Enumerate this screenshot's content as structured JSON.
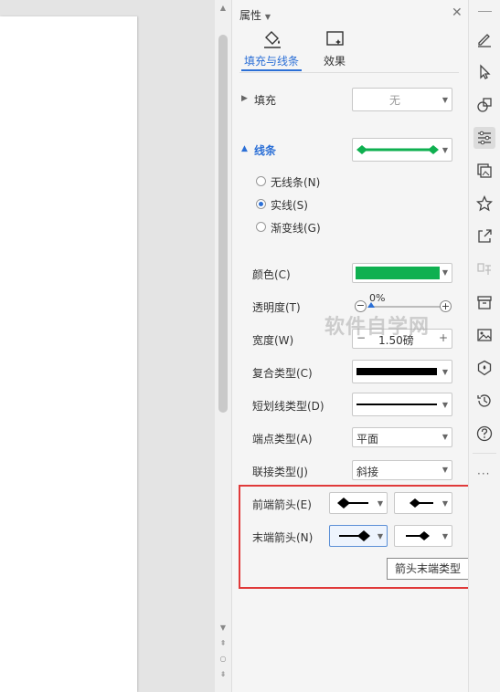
{
  "panel": {
    "title": "属性",
    "tabs": [
      {
        "label": "填充与线条",
        "icon": "fill-bucket-icon",
        "active": true
      },
      {
        "label": "效果",
        "icon": "effects-icon",
        "active": false
      }
    ],
    "fill": {
      "label": "填充",
      "value": "无"
    },
    "line": {
      "label": "线条",
      "options": [
        "无线条(N)",
        "实线(S)",
        "渐变线(G)"
      ],
      "selected": "实线(S)"
    },
    "color": {
      "label": "颜色(C)",
      "value": "#0fb050"
    },
    "transparency": {
      "label": "透明度(T)",
      "value": "0%"
    },
    "width": {
      "label": "宽度(W)",
      "value": "1.50磅"
    },
    "compound": {
      "label": "复合类型(C)"
    },
    "dash": {
      "label": "短划线类型(D)"
    },
    "cap": {
      "label": "端点类型(A)",
      "value": "平面"
    },
    "join": {
      "label": "联接类型(J)",
      "value": "斜接"
    },
    "begin_arrow": {
      "label": "前端箭头(E)"
    },
    "end_arrow": {
      "label": "末端箭头(N)"
    },
    "tooltip": "箭头末端类型"
  },
  "watermark": "软件自学网",
  "colors": {
    "accent": "#2b6fd6",
    "line_green": "#0fb050",
    "highlight": "#e03a3a"
  }
}
